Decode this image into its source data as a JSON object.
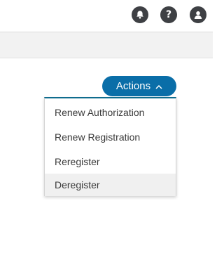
{
  "header": {
    "icons": [
      "bell-icon",
      "help-icon",
      "user-icon"
    ],
    "help_glyph": "?"
  },
  "actions": {
    "label": "Actions",
    "expanded": true,
    "accent_color": "#0a6ea8"
  },
  "menu": {
    "items": [
      {
        "label": "Renew Authorization"
      },
      {
        "label": "Renew Registration"
      },
      {
        "label": "Reregister"
      },
      {
        "label": "Deregister",
        "highlighted": true
      }
    ]
  }
}
